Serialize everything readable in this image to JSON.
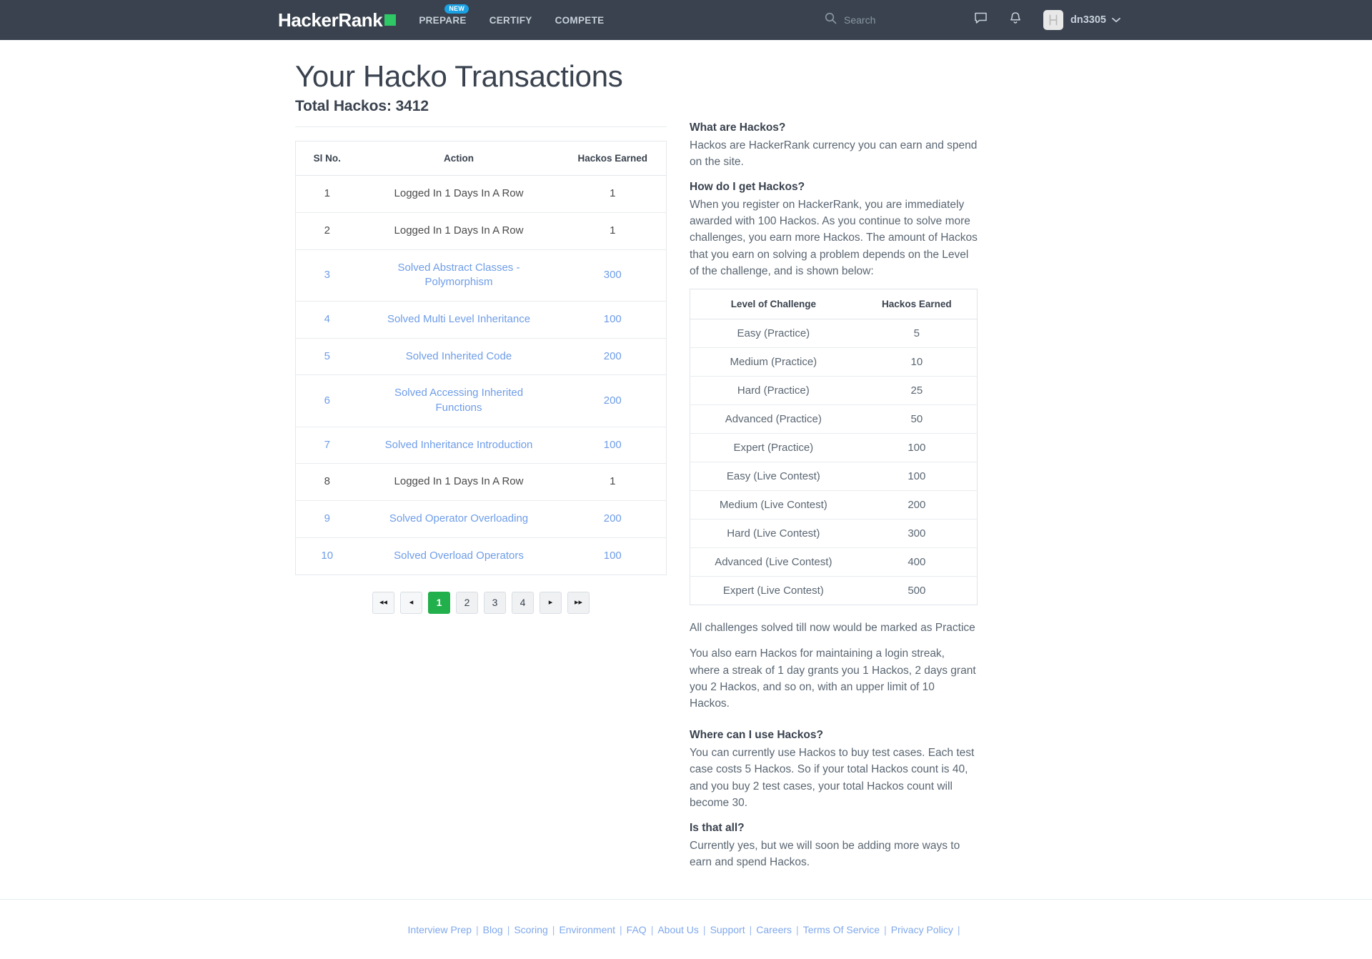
{
  "header": {
    "logo_text": "HackerRank",
    "logo_square_color": "#2ec866",
    "nav": [
      {
        "label": "PREPARE",
        "badge": "NEW"
      },
      {
        "label": "CERTIFY",
        "badge": ""
      },
      {
        "label": "COMPETE",
        "badge": ""
      }
    ],
    "search_placeholder": "Search",
    "search_value": "",
    "avatar_letter": "H",
    "username": "dn3305",
    "bg_color": "#39424e"
  },
  "main": {
    "title": "Your Hacko Transactions",
    "total_hackos_label": "Total Hackos: 3412",
    "total_hackos": 3412,
    "transactions": {
      "columns": [
        "Sl No.",
        "Action",
        "Hackos Earned"
      ],
      "rows": [
        {
          "sl": "1",
          "action": "Logged In 1 Days In A Row",
          "hackos": "1",
          "link": false
        },
        {
          "sl": "2",
          "action": "Logged In 1 Days In A Row",
          "hackos": "1",
          "link": false
        },
        {
          "sl": "3",
          "action": "Solved Abstract Classes - Polymorphism",
          "hackos": "300",
          "link": true
        },
        {
          "sl": "4",
          "action": "Solved Multi Level Inheritance",
          "hackos": "100",
          "link": true
        },
        {
          "sl": "5",
          "action": "Solved Inherited Code",
          "hackos": "200",
          "link": true
        },
        {
          "sl": "6",
          "action": "Solved Accessing Inherited Functions",
          "hackos": "200",
          "link": true
        },
        {
          "sl": "7",
          "action": "Solved Inheritance Introduction",
          "hackos": "100",
          "link": true
        },
        {
          "sl": "8",
          "action": "Logged In 1 Days In A Row",
          "hackos": "1",
          "link": false
        },
        {
          "sl": "9",
          "action": "Solved Operator Overloading",
          "hackos": "200",
          "link": true
        },
        {
          "sl": "10",
          "action": "Solved Overload Operators",
          "hackos": "100",
          "link": true
        }
      ]
    },
    "pagination": {
      "first_label": "◂◂",
      "prev_label": "◂",
      "pages": [
        "1",
        "2",
        "3",
        "4"
      ],
      "active_page": "1",
      "next_label": "▸",
      "last_label": "▸▸",
      "active_color": "#21b04b"
    }
  },
  "sidebar": {
    "q1_heading": "What are Hackos?",
    "q1_body": "Hackos are HackerRank currency you can earn and spend on the site.",
    "q2_heading": "How do I get Hackos?",
    "q2_body": "When you register on HackerRank, you are immediately awarded with 100 Hackos. As you continue to solve more challenges, you earn more Hackos. The amount of Hackos that you earn on solving a problem depends on the Level of the challenge, and is shown below:",
    "levels": {
      "columns": [
        "Level of Challenge",
        "Hackos Earned"
      ],
      "rows": [
        {
          "level": "Easy (Practice)",
          "hackos": "5"
        },
        {
          "level": "Medium (Practice)",
          "hackos": "10"
        },
        {
          "level": "Hard (Practice)",
          "hackos": "25"
        },
        {
          "level": "Advanced (Practice)",
          "hackos": "50"
        },
        {
          "level": "Expert (Practice)",
          "hackos": "100"
        },
        {
          "level": "Easy (Live Contest)",
          "hackos": "100"
        },
        {
          "level": "Medium (Live Contest)",
          "hackos": "200"
        },
        {
          "level": "Hard (Live Contest)",
          "hackos": "300"
        },
        {
          "level": "Advanced (Live Contest)",
          "hackos": "400"
        },
        {
          "level": "Expert (Live Contest)",
          "hackos": "500"
        }
      ]
    },
    "note_practice": "All challenges solved till now would be marked as Practice",
    "note_streak": "You also earn Hackos for maintaining a login streak, where a streak of 1 day grants you 1 Hackos, 2 days grant you 2 Hackos, and so on, with an upper limit of 10 Hackos.",
    "q3_heading": "Where can I use Hackos?",
    "q3_body": "You can currently use Hackos to buy test cases. Each test case costs 5 Hackos. So if your total Hackos count is 40, and you buy 2 test cases, your total Hackos count will become 30.",
    "q4_heading": "Is that all?",
    "q4_body": "Currently yes, but we will soon be adding more ways to earn and spend Hackos."
  },
  "footer": {
    "links": [
      "Interview Prep",
      "Blog",
      "Scoring",
      "Environment",
      "FAQ",
      "About Us",
      "Support",
      "Careers",
      "Terms Of Service",
      "Privacy Policy"
    ],
    "separator": "|"
  }
}
